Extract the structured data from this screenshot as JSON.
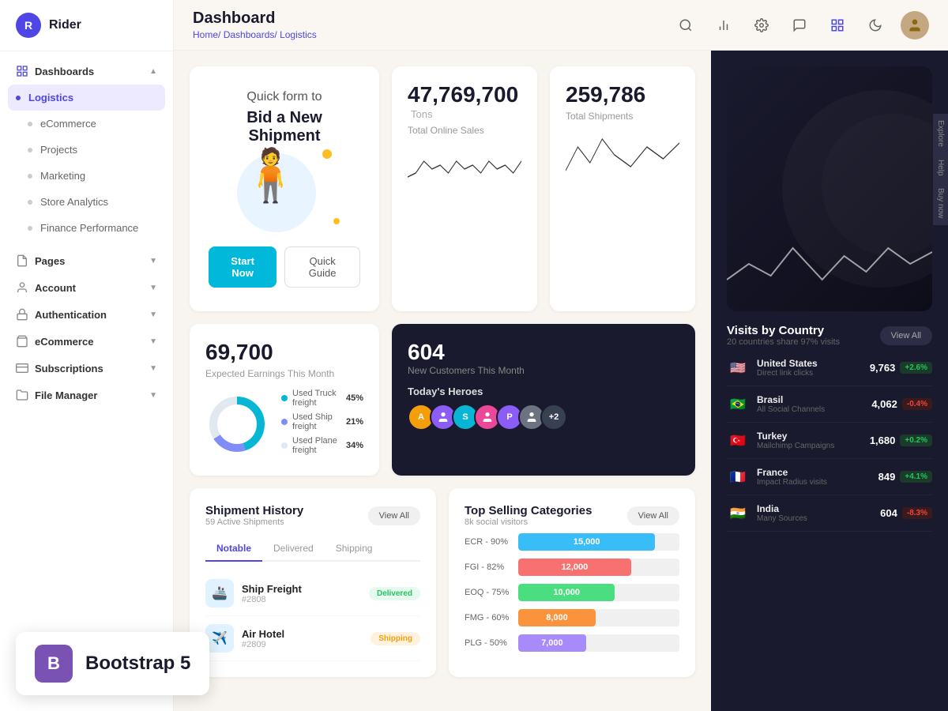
{
  "app": {
    "name": "Rider",
    "logo_letter": "R"
  },
  "header": {
    "title": "Dashboard",
    "breadcrumb_home": "Home/",
    "breadcrumb_dashboards": "Dashboards/",
    "breadcrumb_current": "Logistics"
  },
  "sidebar": {
    "sections": [
      {
        "label": "Dashboards",
        "expanded": true,
        "items": [
          {
            "label": "Logistics",
            "active": true
          },
          {
            "label": "eCommerce",
            "active": false
          },
          {
            "label": "Projects",
            "active": false
          },
          {
            "label": "Marketing",
            "active": false
          },
          {
            "label": "Store Analytics",
            "active": false
          },
          {
            "label": "Finance Performance",
            "active": false
          }
        ]
      },
      {
        "label": "Pages",
        "expanded": false,
        "items": []
      },
      {
        "label": "Account",
        "expanded": false,
        "items": []
      },
      {
        "label": "Authentication",
        "expanded": false,
        "items": []
      },
      {
        "label": "eCommerce",
        "expanded": false,
        "items": []
      },
      {
        "label": "Subscriptions",
        "expanded": false,
        "items": []
      },
      {
        "label": "File Manager",
        "expanded": false,
        "items": []
      }
    ]
  },
  "promo": {
    "line1": "Quick form to",
    "line2": "Bid a New Shipment",
    "btn_primary": "Start Now",
    "btn_secondary": "Quick Guide"
  },
  "stats": {
    "total_sales": {
      "value": "47,769,700",
      "unit": "Tons",
      "label": "Total Online Sales"
    },
    "total_shipments": {
      "value": "259,786",
      "label": "Total Shipments"
    },
    "earnings": {
      "value": "69,700",
      "label": "Expected Earnings This Month"
    },
    "customers": {
      "value": "604",
      "label": "New Customers This Month"
    }
  },
  "freight": {
    "truck": {
      "label": "Used Truck freight",
      "pct": "45%"
    },
    "ship": {
      "label": "Used Ship freight",
      "pct": "21%"
    },
    "plane": {
      "label": "Used Plane freight",
      "pct": "34%"
    }
  },
  "heroes": {
    "label": "Today's Heroes",
    "avatars": [
      {
        "initial": "A",
        "color": "#f59e0b"
      },
      {
        "initial": "",
        "color": "#8b5cf6"
      },
      {
        "initial": "S",
        "color": "#06b6d4"
      },
      {
        "initial": "",
        "color": "#ec4899"
      },
      {
        "initial": "P",
        "color": "#8b5cf6"
      },
      {
        "initial": "",
        "color": "#6b7280"
      },
      {
        "initial": "+2",
        "color": "#374151"
      }
    ]
  },
  "shipment_history": {
    "title": "Shipment History",
    "sub": "59 Active Shipments",
    "view_all": "View All",
    "tabs": [
      "Notable",
      "Delivered",
      "Shipping"
    ],
    "active_tab": "Notable",
    "items": [
      {
        "name": "Ship Freight",
        "id": "#2808",
        "status": "Delivered",
        "status_type": "delivered"
      },
      {
        "name": "Air Hotel",
        "id": "#2809",
        "status": "Shipping",
        "status_type": "shipping"
      }
    ]
  },
  "categories": {
    "title": "Top Selling Categories",
    "sub": "8k social visitors",
    "view_all": "View All",
    "items": [
      {
        "label": "ECR - 90%",
        "value": "15,000",
        "color": "#38bdf8",
        "width": "85%"
      },
      {
        "label": "FGI - 82%",
        "value": "12,000",
        "color": "#f87171",
        "width": "70%"
      },
      {
        "label": "EOQ - 75%",
        "value": "10,000",
        "color": "#4ade80",
        "width": "60%"
      },
      {
        "label": "FMG - 60%",
        "value": "8,000",
        "color": "#fb923c",
        "width": "48%"
      },
      {
        "label": "PLG - 50%",
        "value": "7,000",
        "color": "#a78bfa",
        "width": "42%"
      }
    ]
  },
  "visits": {
    "title": "Visits by Country",
    "sub": "20 countries share 97% visits",
    "view_all": "View All",
    "countries": [
      {
        "flag": "🇺🇸",
        "name": "United States",
        "sub": "Direct link clicks",
        "value": "9,763",
        "change": "+2.6%",
        "up": true
      },
      {
        "flag": "🇧🇷",
        "name": "Brasil",
        "sub": "All Social Channels",
        "value": "4,062",
        "change": "-0.4%",
        "up": false
      },
      {
        "flag": "🇹🇷",
        "name": "Turkey",
        "sub": "Mailchimp Campaigns",
        "value": "1,680",
        "change": "+0.2%",
        "up": true
      },
      {
        "flag": "🇫🇷",
        "name": "France",
        "sub": "Impact Radius visits",
        "value": "849",
        "change": "+4.1%",
        "up": true
      },
      {
        "flag": "🇮🇳",
        "name": "India",
        "sub": "Many Sources",
        "value": "604",
        "change": "-8.3%",
        "up": false
      }
    ]
  },
  "sidebar_labels": [
    "Explore",
    "Help",
    "Buy now"
  ],
  "bootstrap": {
    "letter": "B",
    "text": "Bootstrap 5"
  }
}
